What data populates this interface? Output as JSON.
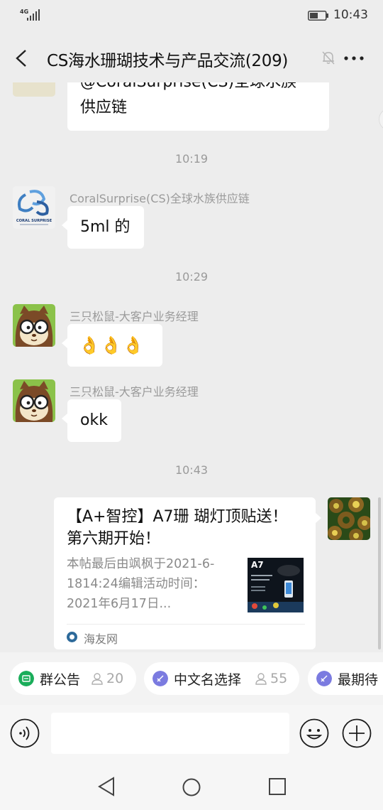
{
  "status_bar": {
    "network": "4G",
    "time": "10:43"
  },
  "header": {
    "title": "CS海水珊瑚技术与产品交流(209)"
  },
  "messages": [
    {
      "type": "partial",
      "lines": [
        "@CoralSurprise(CS)全球水族",
        "供应链"
      ]
    },
    {
      "type": "time",
      "text": "10:19"
    },
    {
      "type": "text",
      "sender": "CoralSurprise(CS)全球水族供应链",
      "text": "5ml 的"
    },
    {
      "type": "time",
      "text": "10:29"
    },
    {
      "type": "text",
      "sender": "三只松鼠-大客户业务经理",
      "text": "👌👌👌"
    },
    {
      "type": "text",
      "sender": "三只松鼠-大客户业务经理",
      "text": "okk"
    },
    {
      "type": "time",
      "text": "10:43"
    },
    {
      "type": "link",
      "title": "【A+智控】A7珊 瑚灯顶贴送！第六期开始！",
      "desc": "本帖最后由飒枫于2021-6-1814:24编辑活动时间：2021年6月17日...",
      "thumb_label": "A7",
      "source": "海友网"
    }
  ],
  "logo_text": "CORAL SURPRISE",
  "chips": [
    {
      "label": "群公告",
      "count": "20",
      "icon": "announcement-icon",
      "color": "#1aad5a"
    },
    {
      "label": "中文名选择",
      "count": "55",
      "icon": "vote-icon",
      "color": "#7b7be0"
    },
    {
      "label": "最期待",
      "count": "",
      "icon": "vote-icon",
      "color": "#7b7be0"
    }
  ],
  "colors": {
    "background": "#ededed",
    "bubble": "#ffffff",
    "chip_green": "#1aad5a",
    "chip_purple": "#7b7be0"
  }
}
